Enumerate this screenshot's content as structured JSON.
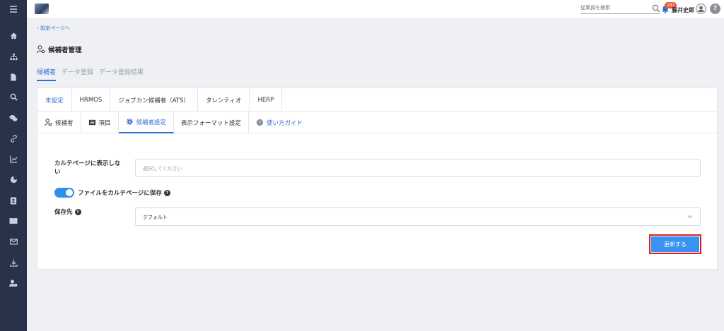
{
  "topbar": {
    "search_placeholder": "従業員を検索",
    "notification_count": "187",
    "user_name": "藤井史郎",
    "help_label": "?"
  },
  "breadcrumb": {
    "back_label": "設定ページへ"
  },
  "page": {
    "title": "候補者管理"
  },
  "main_tabs": [
    {
      "label": "候補者",
      "active": true
    },
    {
      "label": "データ登録",
      "active": false
    },
    {
      "label": "データ登録結果",
      "active": false
    }
  ],
  "ats_tabs": [
    {
      "label": "未設定",
      "active": true
    },
    {
      "label": "HRMOS",
      "active": false
    },
    {
      "label": "ジョブカン候補者（ATS）",
      "active": false
    },
    {
      "label": "タレンティオ",
      "active": false
    },
    {
      "label": "HERP",
      "active": false
    }
  ],
  "sub_tabs": [
    {
      "label": "候補者",
      "icon": "user-gear-icon",
      "active": false
    },
    {
      "label": "項目",
      "icon": "list-icon",
      "active": false
    },
    {
      "label": "候補者設定",
      "icon": "gear-icon",
      "active": true
    },
    {
      "label": "表示フォーマット設定",
      "icon": "",
      "active": false
    },
    {
      "label": "使い方ガイド",
      "icon": "question-circle-icon",
      "active": false
    }
  ],
  "form": {
    "hide_on_karte_label": "カルテページに表示しない",
    "hide_on_karte_placeholder": "選択してください",
    "save_toggle_label": "ファイルをカルテページに保存",
    "save_toggle_on": true,
    "save_dest_label": "保存先",
    "save_dest_value": "デフォルト",
    "update_label": "更新する"
  },
  "colors": {
    "accent": "#2f6fd1",
    "button": "#3a93f2",
    "sidebar": "#28334a",
    "highlight": "#e02020"
  }
}
